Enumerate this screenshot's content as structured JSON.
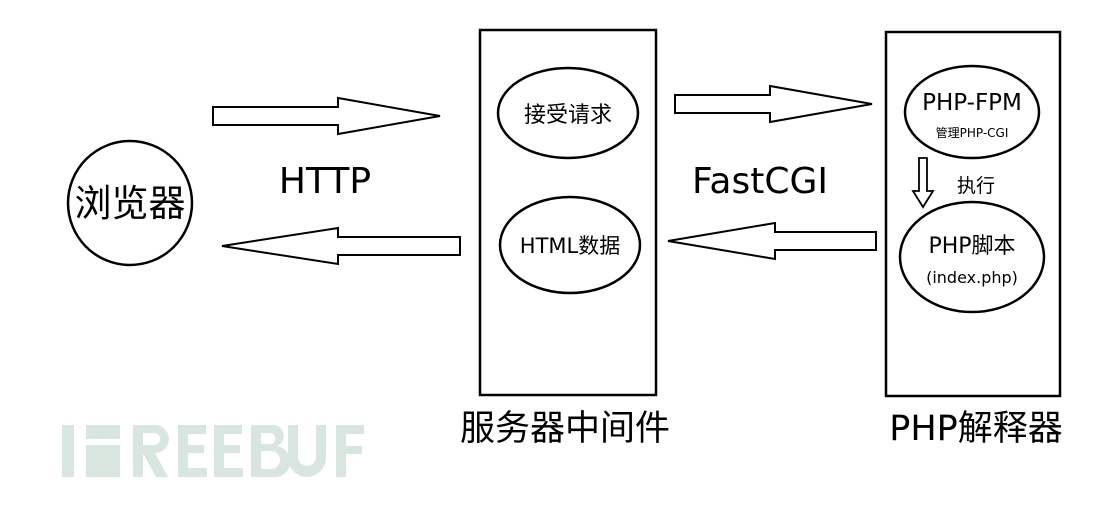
{
  "nodes": {
    "browser": {
      "label": "浏览器"
    },
    "server": {
      "title": "服务器中间件",
      "accept": "接受请求",
      "html_data": "HTML数据"
    },
    "php": {
      "title": "PHP解释器",
      "fpm": "PHP-FPM",
      "fpm_sub": "管理PHP-CGI",
      "execute": "执行",
      "script": "PHP脚本",
      "script_sub": "(index.php)"
    }
  },
  "edges": {
    "http": "HTTP",
    "fastcgi": "FastCGI"
  },
  "watermark": {
    "text": "FREEBUF",
    "color": "#d9e6df"
  },
  "colors": {
    "stroke": "#000000",
    "background": "#ffffff"
  }
}
